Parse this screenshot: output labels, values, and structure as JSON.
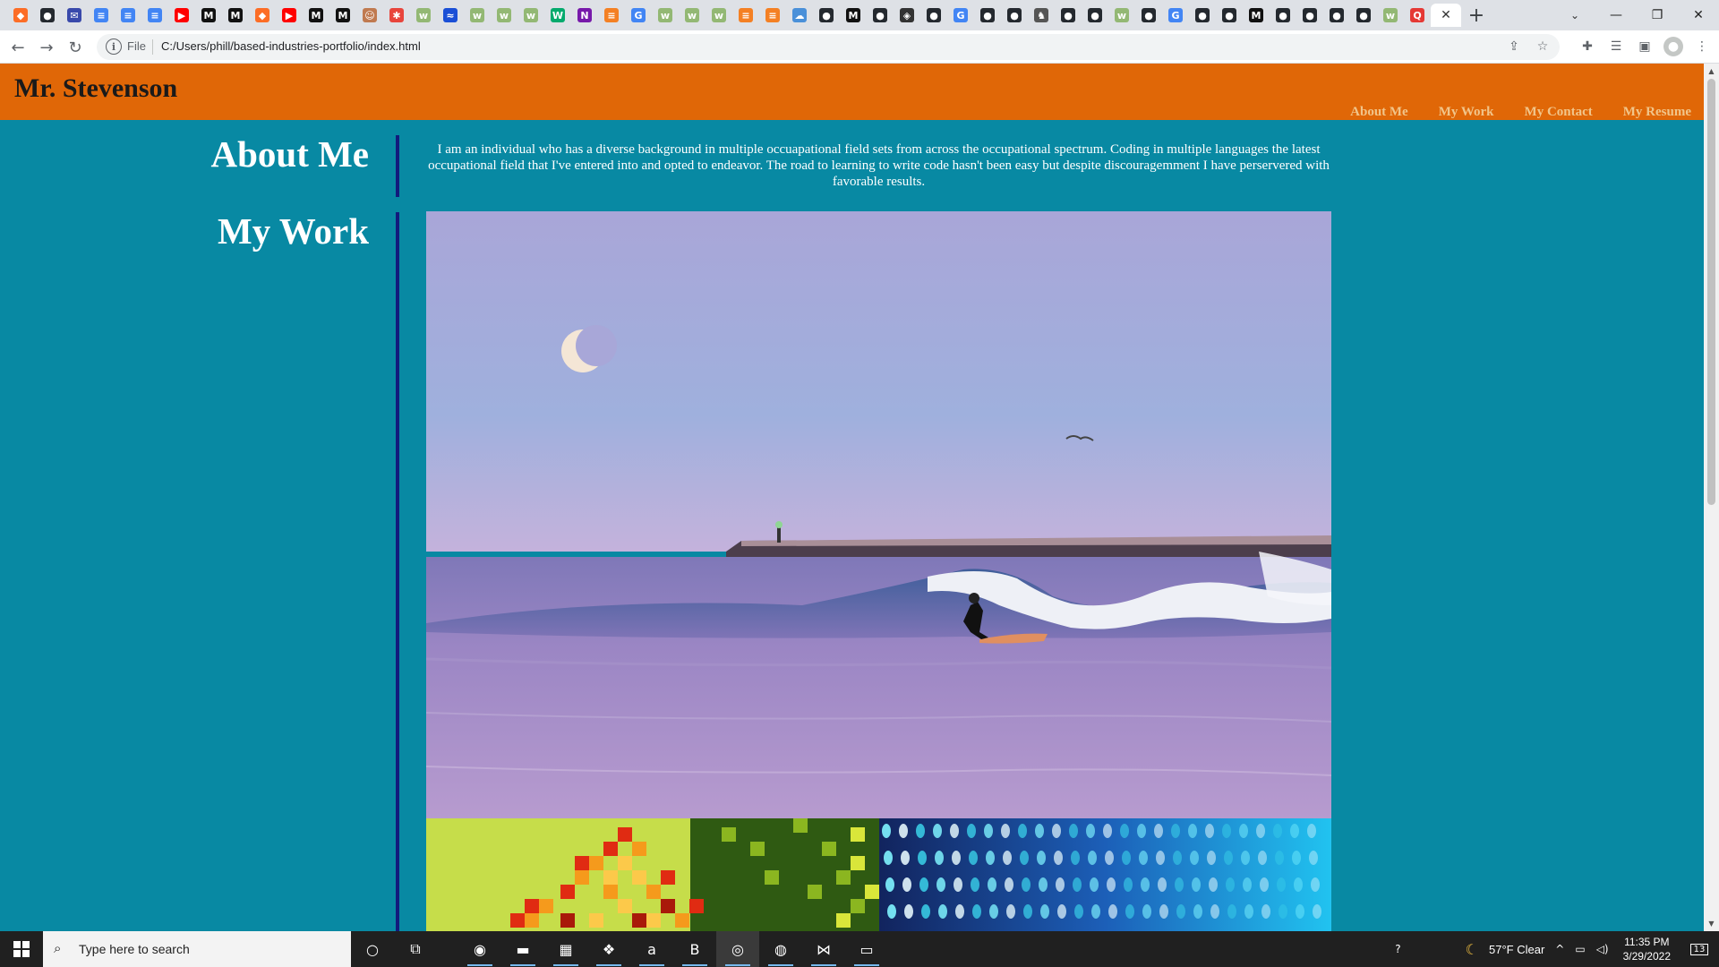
{
  "browser": {
    "tabs": [
      {
        "icon": "gitlab-icon",
        "glyph": "◆",
        "color": "#fc6d26"
      },
      {
        "icon": "github-icon",
        "glyph": "●",
        "color": "#24292f"
      },
      {
        "icon": "mail-icon",
        "glyph": "✉",
        "color": "#3949ab"
      },
      {
        "icon": "docs-icon",
        "glyph": "≡",
        "color": "#4285f4"
      },
      {
        "icon": "docs-icon",
        "glyph": "≡",
        "color": "#4285f4"
      },
      {
        "icon": "docs-icon",
        "glyph": "≡",
        "color": "#4285f4"
      },
      {
        "icon": "youtube-icon",
        "glyph": "▶",
        "color": "#ff0000"
      },
      {
        "icon": "medium-icon",
        "glyph": "M",
        "color": "#111111"
      },
      {
        "icon": "medium-icon",
        "glyph": "M",
        "color": "#111111"
      },
      {
        "icon": "gitlab-icon",
        "glyph": "◆",
        "color": "#fc6d26"
      },
      {
        "icon": "youtube-icon",
        "glyph": "▶",
        "color": "#ff0000"
      },
      {
        "icon": "medium-icon",
        "glyph": "M",
        "color": "#111111"
      },
      {
        "icon": "medium-icon",
        "glyph": "M",
        "color": "#111111"
      },
      {
        "icon": "person-icon",
        "glyph": "☺",
        "color": "#c07a50"
      },
      {
        "icon": "asterisk-icon",
        "glyph": "✱",
        "color": "#e8453c"
      },
      {
        "icon": "wikihow-icon",
        "glyph": "w",
        "color": "#93b874"
      },
      {
        "icon": "wave-icon",
        "glyph": "≈",
        "color": "#1a4fd6"
      },
      {
        "icon": "wikihow-icon",
        "glyph": "w",
        "color": "#93b874"
      },
      {
        "icon": "wikihow-icon",
        "glyph": "w",
        "color": "#93b874"
      },
      {
        "icon": "wikihow-icon",
        "glyph": "w",
        "color": "#93b874"
      },
      {
        "icon": "w3schools-icon",
        "glyph": "W",
        "color": "#04aa6d"
      },
      {
        "icon": "onenote-icon",
        "glyph": "N",
        "color": "#7719aa"
      },
      {
        "icon": "stackoverflow-icon",
        "glyph": "≡",
        "color": "#f48024"
      },
      {
        "icon": "google-icon",
        "glyph": "G",
        "color": "#4285f4"
      },
      {
        "icon": "wikihow-icon",
        "glyph": "w",
        "color": "#93b874"
      },
      {
        "icon": "wikihow-icon",
        "glyph": "w",
        "color": "#93b874"
      },
      {
        "icon": "wikihow-icon",
        "glyph": "w",
        "color": "#93b874"
      },
      {
        "icon": "stackoverflow-icon",
        "glyph": "≡",
        "color": "#f48024"
      },
      {
        "icon": "stackoverflow-icon",
        "glyph": "≡",
        "color": "#f48024"
      },
      {
        "icon": "cloud-icon",
        "glyph": "☁",
        "color": "#4a90d9"
      },
      {
        "icon": "github-icon",
        "glyph": "●",
        "color": "#24292f"
      },
      {
        "icon": "medium-icon",
        "glyph": "M",
        "color": "#111111"
      },
      {
        "icon": "github-icon",
        "glyph": "●",
        "color": "#24292f"
      },
      {
        "icon": "target-icon",
        "glyph": "◈",
        "color": "#333333"
      },
      {
        "icon": "github-icon",
        "glyph": "●",
        "color": "#24292f"
      },
      {
        "icon": "google-icon",
        "glyph": "G",
        "color": "#4285f4"
      },
      {
        "icon": "github-icon",
        "glyph": "●",
        "color": "#24292f"
      },
      {
        "icon": "github-icon",
        "glyph": "●",
        "color": "#24292f"
      },
      {
        "icon": "deer-icon",
        "glyph": "♞",
        "color": "#555555"
      },
      {
        "icon": "github-icon",
        "glyph": "●",
        "color": "#24292f"
      },
      {
        "icon": "github-icon",
        "glyph": "●",
        "color": "#24292f"
      },
      {
        "icon": "wikihow-icon",
        "glyph": "w",
        "color": "#93b874"
      },
      {
        "icon": "github-icon",
        "glyph": "●",
        "color": "#24292f"
      },
      {
        "icon": "google-icon",
        "glyph": "G",
        "color": "#4285f4"
      },
      {
        "icon": "github-icon",
        "glyph": "●",
        "color": "#24292f"
      },
      {
        "icon": "github-icon",
        "glyph": "●",
        "color": "#24292f"
      },
      {
        "icon": "medium-icon",
        "glyph": "M",
        "color": "#111111"
      },
      {
        "icon": "github-icon",
        "glyph": "●",
        "color": "#24292f"
      },
      {
        "icon": "github-icon",
        "glyph": "●",
        "color": "#24292f"
      },
      {
        "icon": "github-icon",
        "glyph": "●",
        "color": "#24292f"
      },
      {
        "icon": "github-icon",
        "glyph": "●",
        "color": "#24292f"
      },
      {
        "icon": "wikihow-icon",
        "glyph": "w",
        "color": "#93b874"
      },
      {
        "icon": "qbet-icon",
        "glyph": "Q",
        "color": "#e53935"
      }
    ],
    "active_tab_close": "✕",
    "new_tab": "+",
    "tab_search": "⌄",
    "window_controls": {
      "minimize": "—",
      "restore": "❐",
      "close": "✕"
    },
    "nav": {
      "back": "←",
      "forward": "→",
      "reload": "↻"
    },
    "address": {
      "info": "i",
      "scheme_label": "File",
      "url": "C:/Users/phill/based-industries-portfolio/index.html"
    },
    "omni_icons": {
      "share": "⇪",
      "bookmark": "☆"
    },
    "toolbar_icons": {
      "extensions": "✚",
      "reading_list": "☰",
      "side_panel": "▣",
      "profile": "●",
      "menu": "⋮"
    }
  },
  "site": {
    "title": "Mr. Stevenson",
    "nav": [
      "About Me",
      "My Work",
      "My Contact",
      "My Resume"
    ],
    "about_heading": "About Me",
    "about_text": "I am an individual who has a diverse background in multiple occuapational field sets from across the occupational spectrum. Coding in multiple languages the latest occupational field that I've entered into and opted to endeavor. The road to learning to write code hasn't been easy but despite discouragemment I have perservered with favorable results.",
    "work_heading": "My Work",
    "colors": {
      "header": "#e06707",
      "background": "#0889a3",
      "nav_link": "#f1c58a",
      "divider": "#121b7c"
    }
  },
  "scrollbar": {
    "up": "▲",
    "down": "▼"
  },
  "taskbar": {
    "search_placeholder": "Type here to search",
    "search_icon": "⌕",
    "apps": [
      {
        "name": "cortana-icon",
        "glyph": "○"
      },
      {
        "name": "task-view-icon",
        "glyph": "⧉"
      },
      {
        "name": "edge-icon",
        "glyph": "◉"
      },
      {
        "name": "file-explorer-icon",
        "glyph": "▬"
      },
      {
        "name": "store-icon",
        "glyph": "▦"
      },
      {
        "name": "dropbox-icon",
        "glyph": "❖"
      },
      {
        "name": "amazon-icon",
        "glyph": "a"
      },
      {
        "name": "b-app-icon",
        "glyph": "B"
      },
      {
        "name": "chrome-icon",
        "glyph": "◎"
      },
      {
        "name": "globe-app-icon",
        "glyph": "◍"
      },
      {
        "name": "vscode-icon",
        "glyph": "⋈"
      },
      {
        "name": "terminal-icon",
        "glyph": "▭"
      }
    ],
    "tray": {
      "help": "?",
      "weather_icon": "☾",
      "weather": "57°F  Clear",
      "chevron": "^",
      "battery": "▭",
      "volume": "◁)",
      "time": "11:35 PM",
      "date": "3/29/2022",
      "notifications": "13"
    }
  }
}
